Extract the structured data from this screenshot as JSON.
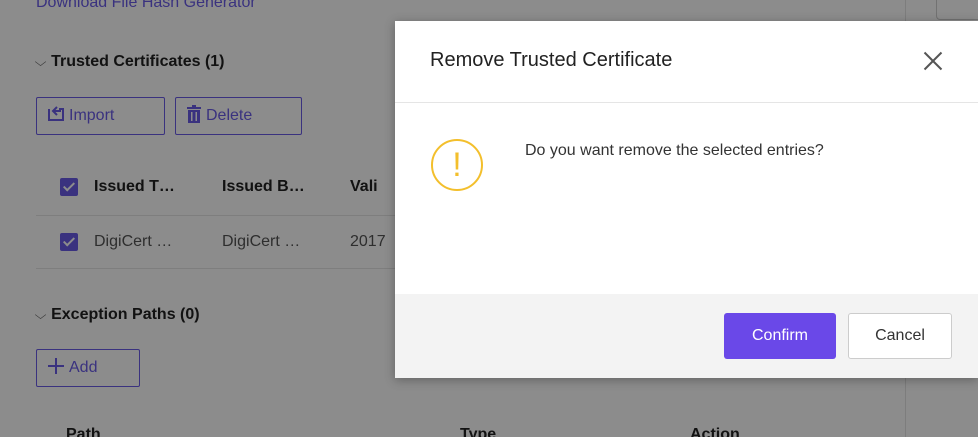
{
  "background": {
    "top_link": "Download File Hash Generator",
    "trusted_section": {
      "title": "Trusted Certificates (1)"
    },
    "import_label": "Import",
    "delete_label": "Delete",
    "table": {
      "headers": [
        "Issued T…",
        "Issued B…",
        "Vali"
      ],
      "row": [
        "DigiCert …",
        "DigiCert …",
        "2017"
      ]
    },
    "exceptions_section": {
      "title": "Exception Paths (0)"
    },
    "add_label": "Add",
    "path_headers": [
      "Path",
      "Type",
      "Action"
    ]
  },
  "modal": {
    "title": "Remove Trusted Certificate",
    "message": "Do you want remove the selected entries?",
    "warning_glyph": "!",
    "confirm_label": "Confirm",
    "cancel_label": "Cancel"
  },
  "colors": {
    "accent": "#6a48e8",
    "warning": "#f3bf2c"
  }
}
